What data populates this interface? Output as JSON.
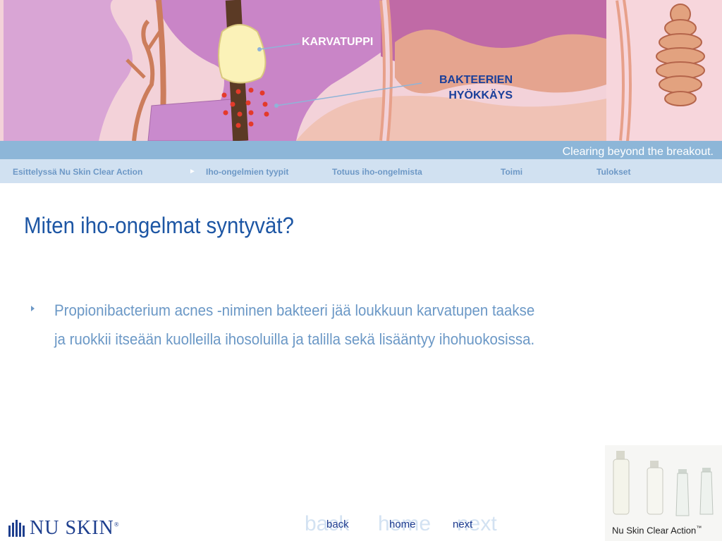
{
  "banner": {
    "label_follicle": "KARVATUPPI",
    "label_bacteria_line1": "BAKTEERIEN",
    "label_bacteria_line2": "HYÖKKÄYS"
  },
  "tagline": "Clearing beyond the breakout.",
  "nav": {
    "items": [
      {
        "label": "Esittelyssä Nu Skin Clear Action"
      },
      {
        "label": "Iho-ongelmien tyypit"
      },
      {
        "label": "Totuus iho-ongelmista"
      },
      {
        "label": "Toimi"
      },
      {
        "label": "Tulokset"
      }
    ]
  },
  "content": {
    "title": "Miten iho-ongelmat  syntyvät?",
    "bullet": "Propionibacterium acnes -niminen bakteeri jää loukkuun karvatupen taakse ja ruokkii itseään kuolleilla ihosoluilla ja talilla sekä lisääntyy ihohuokosissa."
  },
  "footer": {
    "back_ghost": "back",
    "home_ghost": "home",
    "next_ghost": "next",
    "back_label": "back",
    "home_label": "home",
    "next_label": "next",
    "logo_text": "NU SKIN",
    "product_caption": "Nu Skin Clear Action",
    "trademark": "™"
  },
  "colors": {
    "strip": "#8db6d8",
    "nav_bg": "#d1e1f1",
    "title": "#1d56a4",
    "body_text": "#6b98c6",
    "link": "#1c3a8e"
  }
}
